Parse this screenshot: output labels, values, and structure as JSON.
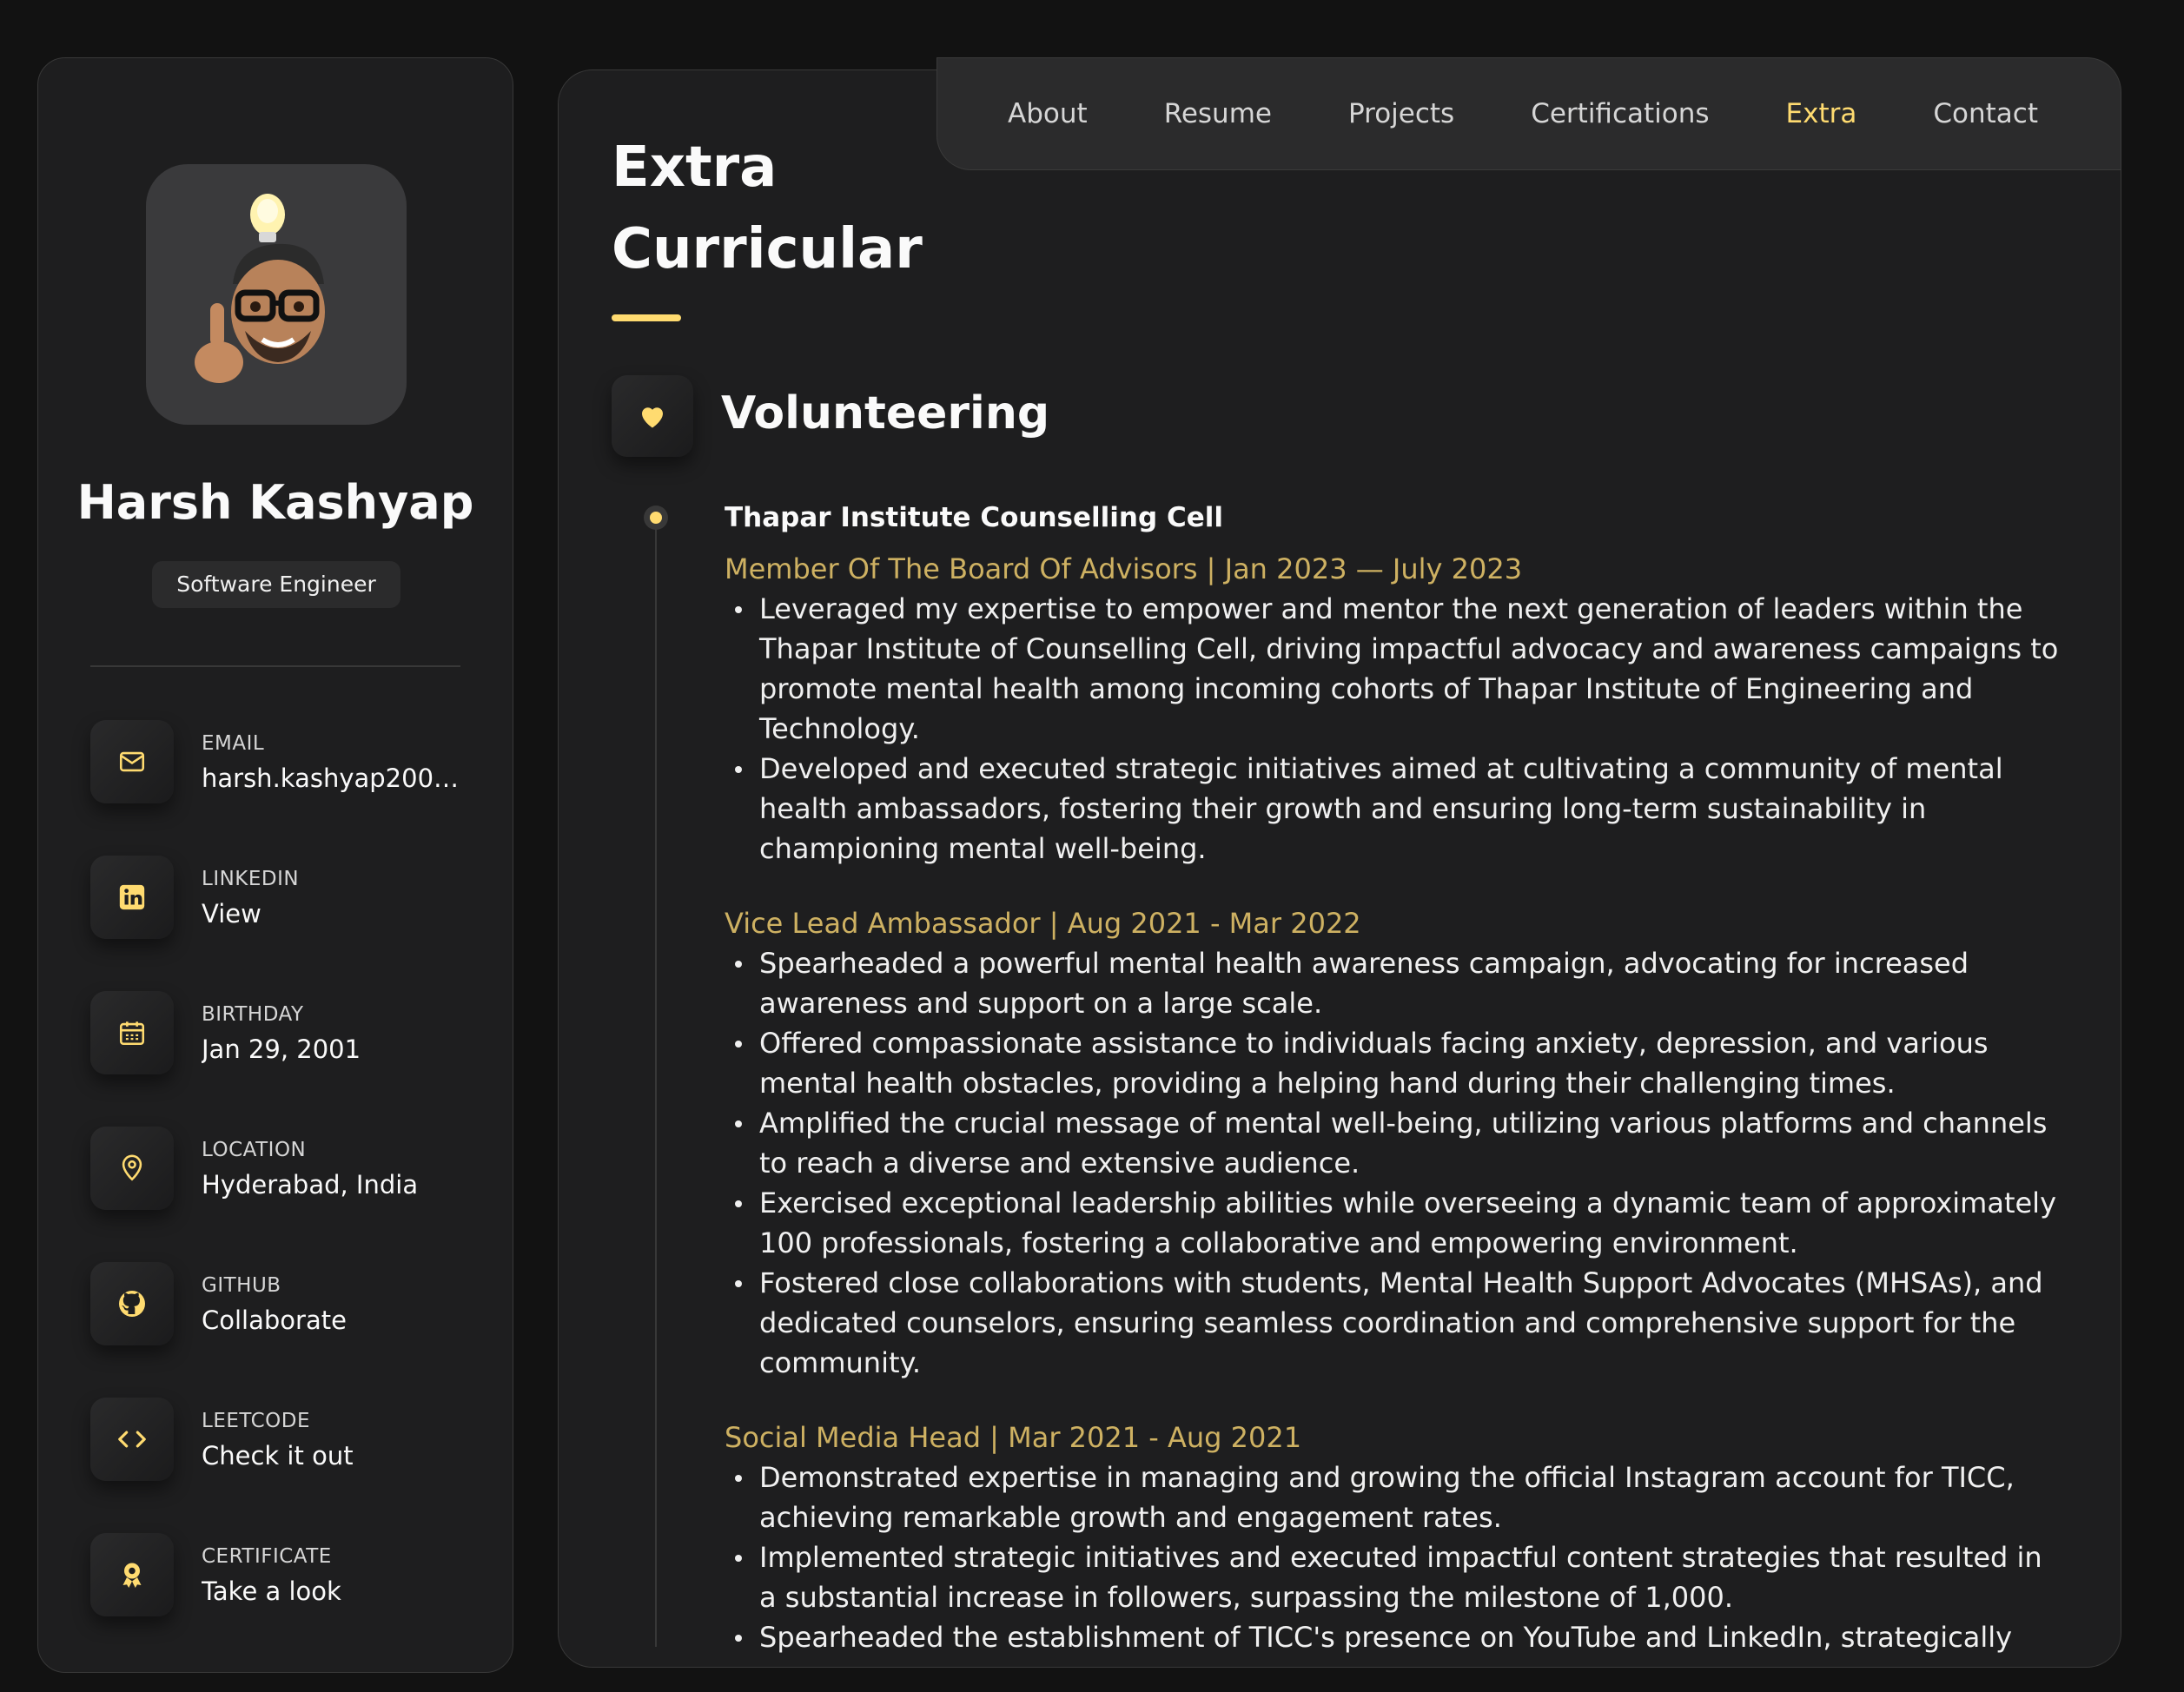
{
  "profile": {
    "name": "Harsh Kashyap",
    "title": "Software Engineer"
  },
  "contacts": [
    {
      "label": "EMAIL",
      "value": "harsh.kashyap2001...",
      "icon": "mail-icon"
    },
    {
      "label": "LINKEDIN",
      "value": "View",
      "icon": "linkedin-icon"
    },
    {
      "label": "BIRTHDAY",
      "value": "Jan 29, 2001",
      "icon": "calendar-icon"
    },
    {
      "label": "LOCATION",
      "value": "Hyderabad, India",
      "icon": "location-pin-icon"
    },
    {
      "label": "GITHUB",
      "value": "Collaborate",
      "icon": "github-icon"
    },
    {
      "label": "LEETCODE",
      "value": "Check it out",
      "icon": "code-icon"
    },
    {
      "label": "CERTIFICATE",
      "value": "Take a look",
      "icon": "award-icon"
    }
  ],
  "nav": {
    "items": [
      "About",
      "Resume",
      "Projects",
      "Certifications",
      "Extra",
      "Contact"
    ],
    "active": "Extra"
  },
  "page": {
    "title_line1": "Extra",
    "title_line2": "Curricular"
  },
  "section": {
    "title": "Volunteering",
    "icon": "heart-icon",
    "org": "Thapar Institute Counselling Cell",
    "roles": [
      {
        "heading": "Member Of The Board Of Advisors | Jan 2023 — July 2023",
        "points": [
          "Leveraged my expertise to empower and mentor the next generation of leaders within the Thapar Institute of Counselling Cell, driving impactful advocacy and awareness campaigns to promote mental health among incoming cohorts of Thapar Institute of Engineering and Technology.",
          "Developed and executed strategic initiatives aimed at cultivating a community of mental health ambassadors, fostering their growth and ensuring long-term sustainability in championing mental well-being."
        ]
      },
      {
        "heading": "Vice Lead Ambassador | Aug 2021 - Mar 2022",
        "points": [
          "Spearheaded a powerful mental health awareness campaign, advocating for increased awareness and support on a large scale.",
          "Offered compassionate assistance to individuals facing anxiety, depression, and various mental health obstacles, providing a helping hand during their challenging times.",
          "Amplified the crucial message of mental well-being, utilizing various platforms and channels to reach a diverse and extensive audience.",
          "Exercised exceptional leadership abilities while overseeing a dynamic team of approximately 100 professionals, fostering a collaborative and empowering environment.",
          "Fostered close collaborations with students, Mental Health Support Advocates (MHSAs), and dedicated counselors, ensuring seamless coordination and comprehensive support for the community."
        ]
      },
      {
        "heading": "Social Media Head | Mar 2021 - Aug 2021",
        "points": [
          "Demonstrated expertise in managing and growing the official Instagram account for TICC, achieving remarkable growth and engagement rates.",
          "Implemented strategic initiatives and executed impactful content strategies that resulted in a substantial increase in followers, surpassing the milestone of 1,000.",
          "Spearheaded the establishment of TICC's presence on YouTube and LinkedIn, strategically"
        ]
      }
    ]
  },
  "colors": {
    "accent": "#ffdb70",
    "role_heading": "#ceb162",
    "background": "#121212",
    "card": "#1e1e1f"
  }
}
